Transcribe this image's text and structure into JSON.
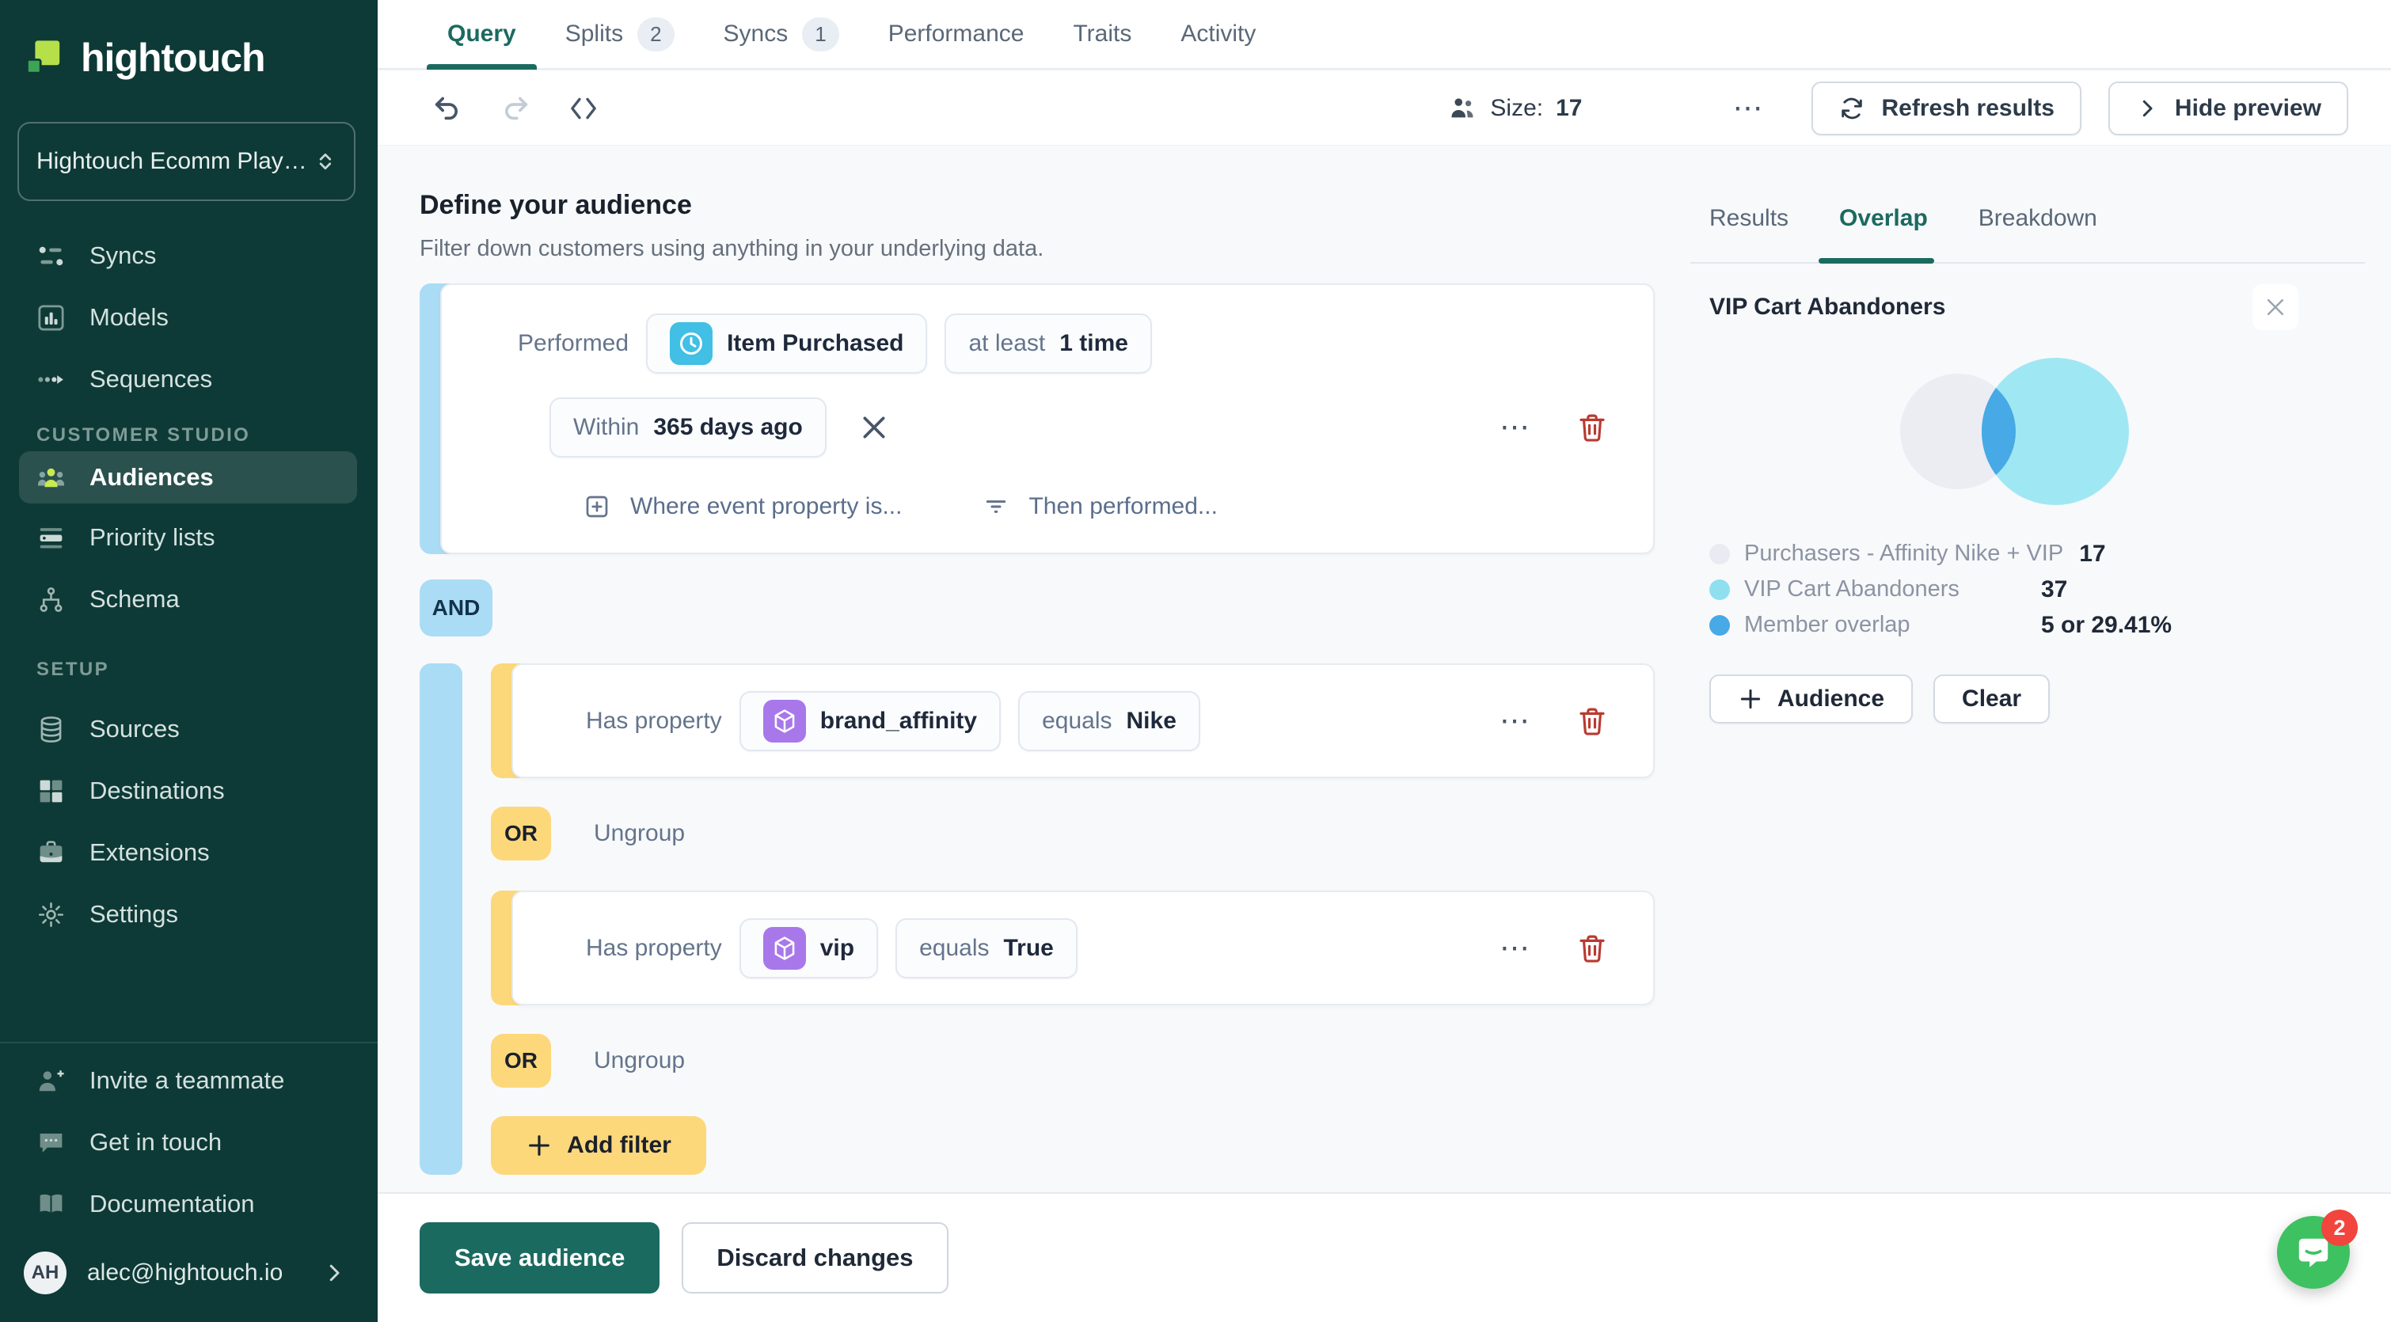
{
  "sidebar": {
    "logo_text": "hightouch",
    "workspace": "Hightouch Ecomm Playg...",
    "nav": [
      {
        "label": "Syncs"
      },
      {
        "label": "Models"
      },
      {
        "label": "Sequences"
      }
    ],
    "section_customer_studio": "CUSTOMER STUDIO",
    "nav_customer": [
      {
        "label": "Audiences"
      },
      {
        "label": "Priority lists"
      },
      {
        "label": "Schema"
      }
    ],
    "section_setup": "SETUP",
    "nav_setup": [
      {
        "label": "Sources"
      },
      {
        "label": "Destinations"
      },
      {
        "label": "Extensions"
      },
      {
        "label": "Settings"
      }
    ],
    "footer_links": [
      {
        "label": "Invite a teammate"
      },
      {
        "label": "Get in touch"
      },
      {
        "label": "Documentation"
      }
    ],
    "user": {
      "initials": "AH",
      "email": "alec@hightouch.io"
    }
  },
  "tabs": [
    {
      "label": "Query"
    },
    {
      "label": "Splits",
      "badge": "2"
    },
    {
      "label": "Syncs",
      "badge": "1"
    },
    {
      "label": "Performance"
    },
    {
      "label": "Traits"
    },
    {
      "label": "Activity"
    }
  ],
  "toolbar": {
    "size_label": "Size:",
    "size_value": "17",
    "ellipsis": "⋯",
    "refresh_label": "Refresh results",
    "hide_preview_label": "Hide preview"
  },
  "editor": {
    "title": "Define your audience",
    "subtitle": "Filter down customers using anything in your underlying data.",
    "performed_card": {
      "prefix": "Performed",
      "event": "Item Purchased",
      "qualifier_prefix": "at least",
      "qualifier_value": "1 time",
      "window_prefix": "Within",
      "window_value": "365 days ago",
      "add_property": "Where event property is...",
      "then_performed": "Then performed...",
      "ellipsis": "⋯"
    },
    "and_label": "AND",
    "or_label": "OR",
    "ungroup_label": "Ungroup",
    "conditions": [
      {
        "prefix": "Has property",
        "property": "brand_affinity",
        "operator": "equals",
        "value": "Nike",
        "ellipsis": "⋯"
      },
      {
        "prefix": "Has property",
        "property": "vip",
        "operator": "equals",
        "value": "True",
        "ellipsis": "⋯"
      }
    ],
    "add_filter_label": "Add filter"
  },
  "preview": {
    "tabs": [
      {
        "label": "Results"
      },
      {
        "label": "Overlap"
      },
      {
        "label": "Breakdown"
      }
    ],
    "title": "VIP Cart Abandoners",
    "venn": {
      "left_size": 17,
      "right_size": 37,
      "overlap_size": 5,
      "overlap_pct": "29.41%"
    },
    "legend": [
      {
        "label": "Purchasers - Affinity Nike + VIP",
        "value": "17",
        "color": "#e9ebf2"
      },
      {
        "label": "VIP Cart Abandoners",
        "value": "37",
        "color": "#8fdff0"
      },
      {
        "label": "Member overlap",
        "value": "5 or 29.41%",
        "color": "#47a9e5"
      }
    ],
    "add_audience_label": "Audience",
    "clear_label": "Clear"
  },
  "footer": {
    "save": "Save audience",
    "discard": "Discard changes"
  },
  "intercom": {
    "badge": "2"
  },
  "colors": {
    "sidebar_bg": "#0d3a36",
    "accent_teal": "#1b6a60",
    "bar_blue": "#aadcf5",
    "bar_yellow": "#fcd87a",
    "event_icon_bg": "#41bfe5",
    "property_icon_bg": "#a878ea",
    "venn_left": "#ebedf3",
    "venn_right": "#a0e7f4",
    "venn_overlap": "#47a9e5",
    "intercom_green": "#3ec161",
    "badge_red": "#f1453d"
  }
}
